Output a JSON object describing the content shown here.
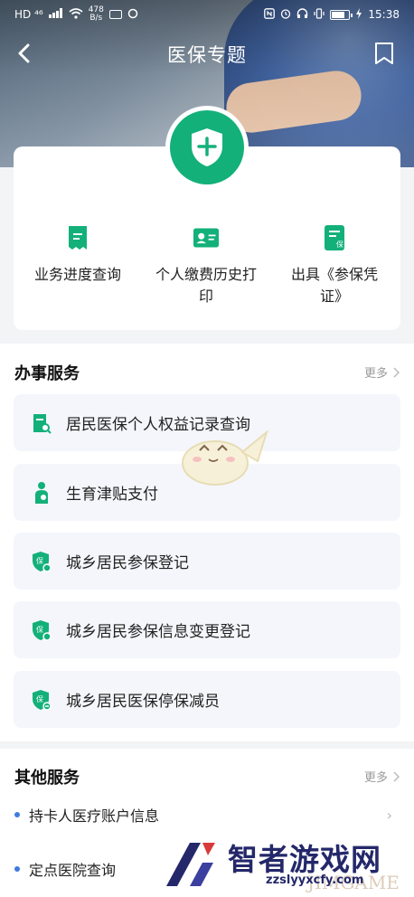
{
  "status_bar": {
    "left_text": "HD ⁴⁶",
    "net_speed_value": "478",
    "net_speed_unit": "B/s",
    "time": "15:38"
  },
  "navbar": {
    "title": "医保专题"
  },
  "quick_actions": [
    {
      "label": "业务进度查询",
      "icon": "document-icon"
    },
    {
      "label": "个人缴费历史打印",
      "icon": "id-card-icon"
    },
    {
      "label": "出具《参保凭证》",
      "icon": "insurance-certificate-icon"
    }
  ],
  "services": {
    "title": "办事服务",
    "more": "更多",
    "items": [
      {
        "label": "居民医保个人权益记录查询",
        "icon": "record-search-icon"
      },
      {
        "label": "生育津贴支付",
        "icon": "maternity-icon"
      },
      {
        "label": "城乡居民参保登记",
        "icon": "shield-register-icon"
      },
      {
        "label": "城乡居民参保信息变更登记",
        "icon": "shield-edit-icon"
      },
      {
        "label": "城乡居民医保停保减员",
        "icon": "shield-minus-icon"
      }
    ]
  },
  "other_services": {
    "title": "其他服务",
    "more": "更多",
    "items": [
      {
        "label": "持卡人医疗账户信息"
      },
      {
        "label": "定点医院查询"
      }
    ]
  },
  "watermark": {
    "name": "智者游戏网",
    "url": "zzslyyxcfy.com",
    "ghost": "JIMGAME"
  },
  "colors": {
    "accent_green": "#13b07a",
    "bullet_blue": "#3e7be0",
    "service_bg": "#f4f6fb"
  }
}
